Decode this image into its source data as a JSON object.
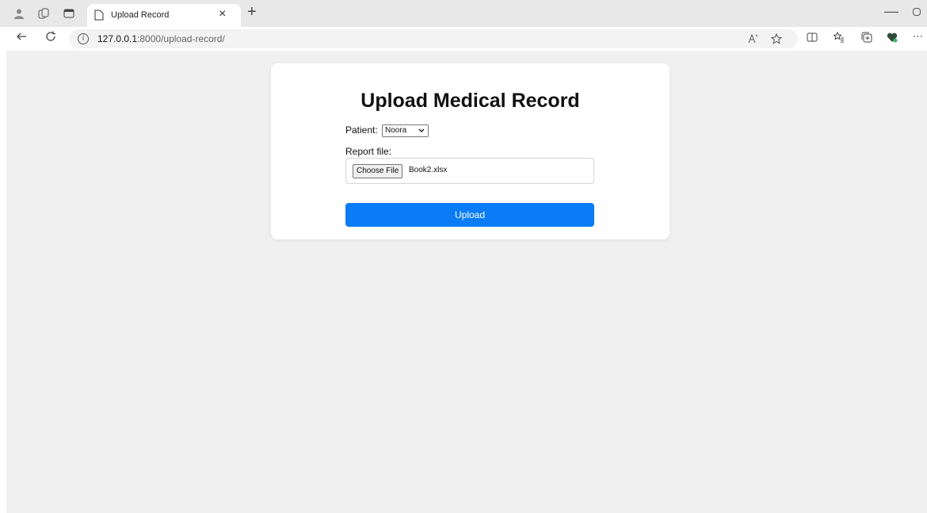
{
  "browser": {
    "tab_title": "Upload Record",
    "tab_close": "×",
    "new_tab": "+",
    "url_host": "127.0.0.1",
    "url_rest": ":8000/upload-record/",
    "minimize": "—",
    "more": "⋯"
  },
  "page": {
    "heading": "Upload Medical Record",
    "patient_label": "Patient:",
    "patient_selected": "Noora",
    "file_label": "Report file:",
    "choose_file_label": "Choose File",
    "file_name": "Book2.xlsx",
    "upload_label": "Upload"
  },
  "colors": {
    "upload_button": "#0b7cf5",
    "page_background": "#f0f0f0"
  }
}
